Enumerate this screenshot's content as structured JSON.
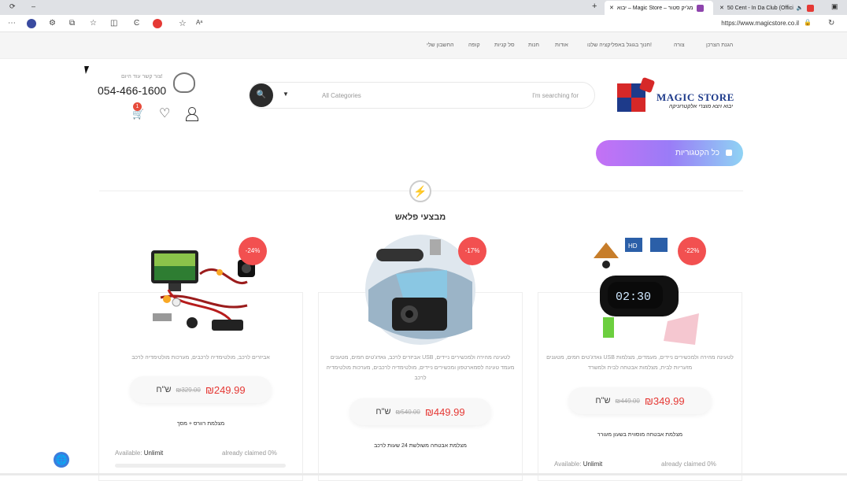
{
  "browser": {
    "tabs": [
      {
        "title": "יבוא – Magic Store – מג'יק סטור",
        "color": "#8e44ad"
      },
      {
        "title": "50 Cent - In Da Club (Offici",
        "color": "#e53935"
      }
    ],
    "url": "https://www.magicstore.co.il"
  },
  "topnav": {
    "links": [
      "הגנת הצרכן",
      "צורה",
      "חנוך בגוגל באפליקציה שלנו!",
      "אודות",
      "חנות",
      "סל קניות",
      "קופה",
      "החשבון שלי"
    ]
  },
  "header": {
    "contact_hint": "צור קשר עוד היום!",
    "phone": "054-466-1600",
    "cart_count": "1",
    "search_categories": "All Categories",
    "search_placeholder": "I'm searching for",
    "logo_name": "MAGIC STORE",
    "logo_tagline": "יבוא ויצא מוצרי אלקטרוניקה"
  },
  "all_categories_label": "כל הקטגוריות",
  "flash": {
    "title": "מבצעי פלאש"
  },
  "products": [
    {
      "discount": "-24%",
      "desc": "אביזרים לרכב, מולטימדיה לרכבים, מערכות מולטימדיה לרכב",
      "price_now": "₪249.99",
      "price_old": "₪329.00",
      "currency": "ש\"ח",
      "title": "מצלמת רוורס + מסך",
      "available_label": "Available:",
      "available_value": "Unlimit",
      "claimed_label": "already claimed",
      "claimed_value": "0%"
    },
    {
      "discount": "-17%",
      "desc": "אביזרים לרכב, גאדג'טים חמים, מטענים USB לטעינה מהירה ולמכשירים ניידים, מעמד טעינה לסמארטפון ומכשירים ניידים, מולטימדיה לרכבים, מערכות מולטימדיה לרכב",
      "price_now": "₪449.99",
      "price_old": "₪540.00",
      "currency": "ש\"ח",
      "title": "מצלמת אבטחה משולשת 24 שעות לרכב"
    },
    {
      "discount": "-22%",
      "desc": "גאדג'טים חמים, מטענים USB לטעינה מהירה ולמכשירים ניידים, מעמדים, מצלמות מזעריות לבית, מצלמות אבטחה לבית ולמשרד",
      "price_now": "₪349.99",
      "price_old": "₪449.00",
      "currency": "ש\"ח",
      "title": "מצלמת אבטחה מוסווית בשעון מעורר",
      "available_label": "Available:",
      "available_value": "Unlimit",
      "claimed_label": "already claimed",
      "claimed_value": "0%"
    }
  ]
}
